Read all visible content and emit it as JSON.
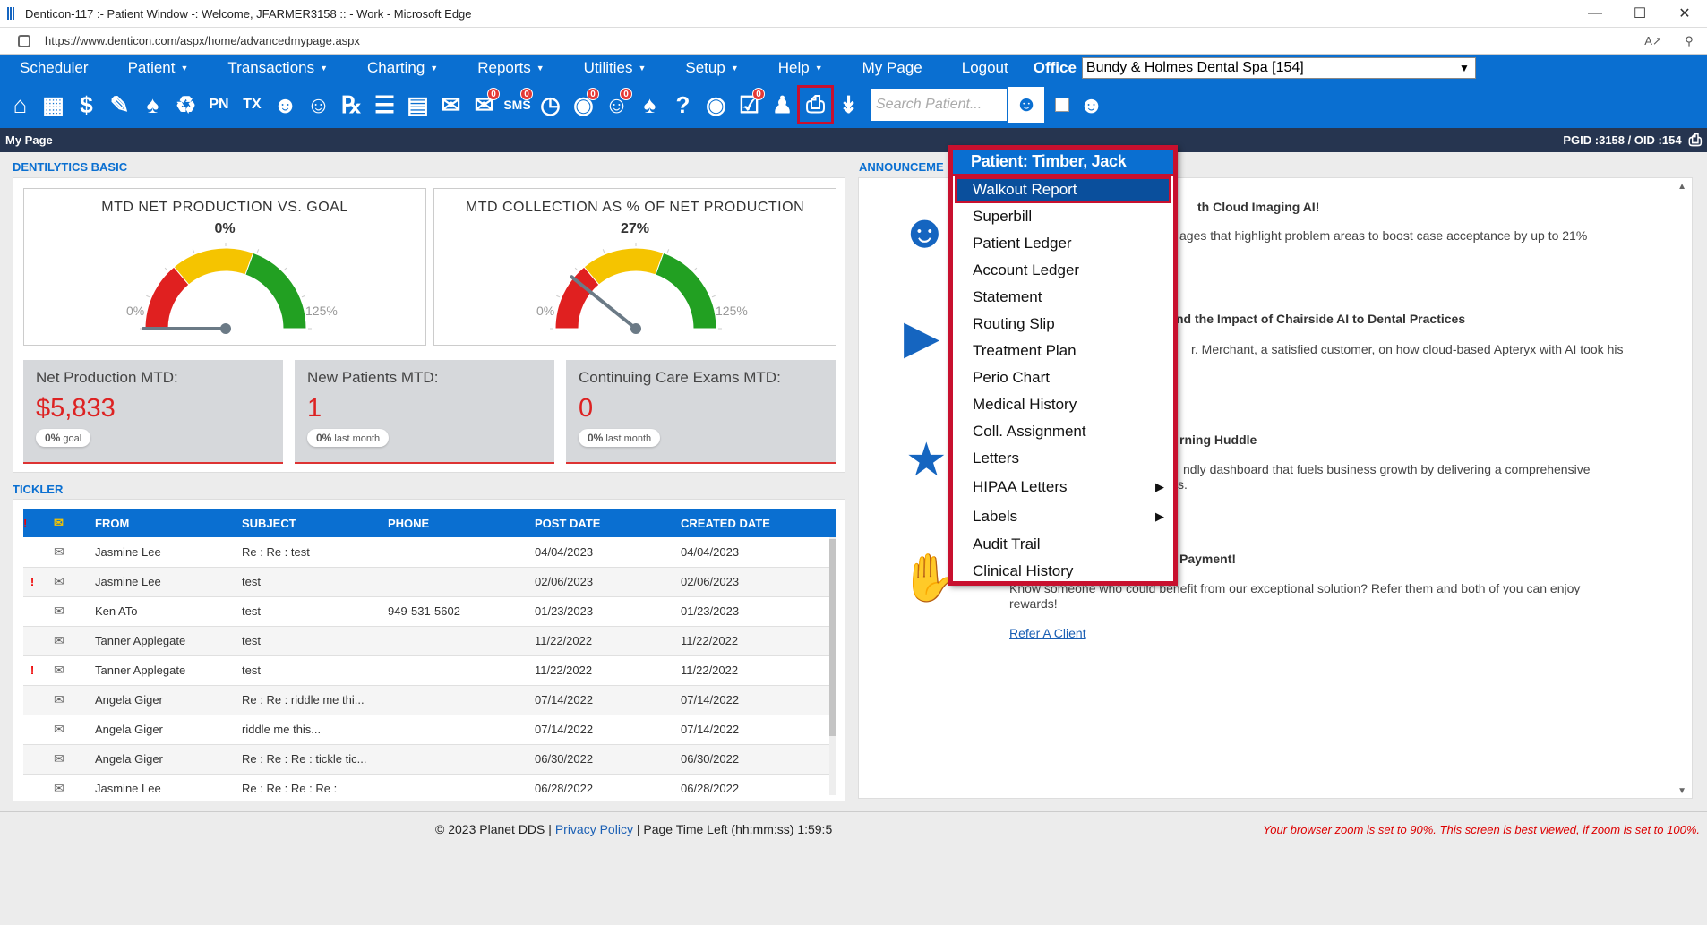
{
  "window": {
    "title": "Denticon-117 :- Patient Window -: Welcome, JFARMER3158 :: - Work - Microsoft Edge",
    "url": "https://www.denticon.com/aspx/home/advancedmypage.aspx"
  },
  "menu": {
    "items": [
      {
        "label": "Scheduler",
        "caret": false
      },
      {
        "label": "Patient",
        "caret": true
      },
      {
        "label": "Transactions",
        "caret": true
      },
      {
        "label": "Charting",
        "caret": true
      },
      {
        "label": "Reports",
        "caret": true
      },
      {
        "label": "Utilities",
        "caret": true
      },
      {
        "label": "Setup",
        "caret": true
      },
      {
        "label": "Help",
        "caret": true
      },
      {
        "label": "My Page",
        "caret": false
      },
      {
        "label": "Logout",
        "caret": false
      }
    ],
    "office_label": "Office",
    "office_value": "Bundy & Holmes Dental Spa [154]"
  },
  "toolbar": {
    "search_placeholder": "Search Patient..."
  },
  "page_header": {
    "title": "My Page",
    "ids": "PGID :3158  /  OID :154"
  },
  "dentilytics": {
    "section_title": "DENTILYTICS BASIC",
    "gauges": [
      {
        "title": "MTD NET PRODUCTION VS. GOAL",
        "value": "0%",
        "min_label": "0%",
        "max_label": "125%",
        "fraction": 0.0
      },
      {
        "title": "MTD COLLECTION AS % OF NET PRODUCTION",
        "value": "27%",
        "min_label": "0%",
        "max_label": "125%",
        "fraction": 0.216
      }
    ],
    "stats": [
      {
        "title": "Net Production MTD:",
        "value": "$5,833",
        "pill_pct": "0%",
        "pill_text": "goal"
      },
      {
        "title": "New Patients MTD:",
        "value": "1",
        "pill_pct": "0%",
        "pill_text": "last month"
      },
      {
        "title": "Continuing Care Exams MTD:",
        "value": "0",
        "pill_pct": "0%",
        "pill_text": "last month"
      }
    ]
  },
  "tickler": {
    "section_title": "TICKLER",
    "columns": [
      "FROM",
      "SUBJECT",
      "PHONE",
      "POST DATE",
      "CREATED DATE"
    ],
    "rows": [
      {
        "flag": "",
        "from": "Jasmine Lee",
        "subject": "Re : Re : test",
        "phone": "",
        "post": "04/04/2023",
        "created": "04/04/2023"
      },
      {
        "flag": "!",
        "from": "Jasmine Lee",
        "subject": "test",
        "phone": "",
        "post": "02/06/2023",
        "created": "02/06/2023"
      },
      {
        "flag": "",
        "from": "Ken ATo",
        "subject": "test",
        "phone": "949-531-5602",
        "post": "01/23/2023",
        "created": "01/23/2023"
      },
      {
        "flag": "",
        "from": "Tanner Applegate",
        "subject": "test",
        "phone": "",
        "post": "11/22/2022",
        "created": "11/22/2022"
      },
      {
        "flag": "!",
        "from": "Tanner Applegate",
        "subject": "test",
        "phone": "",
        "post": "11/22/2022",
        "created": "11/22/2022"
      },
      {
        "flag": "",
        "from": "Angela Giger",
        "subject": "Re : Re : riddle me thi...",
        "phone": "",
        "post": "07/14/2022",
        "created": "07/14/2022"
      },
      {
        "flag": "",
        "from": "Angela Giger",
        "subject": "riddle me this...",
        "phone": "",
        "post": "07/14/2022",
        "created": "07/14/2022"
      },
      {
        "flag": "",
        "from": "Angela Giger",
        "subject": "Re : Re : Re : tickle tic...",
        "phone": "",
        "post": "06/30/2022",
        "created": "06/30/2022"
      },
      {
        "flag": "",
        "from": "Jasmine Lee",
        "subject": "Re : Re : Re : Re :",
        "phone": "",
        "post": "06/28/2022",
        "created": "06/28/2022"
      }
    ]
  },
  "announcements": {
    "section_title": "ANNOUNCEME",
    "items": [
      {
        "head": "th Cloud Imaging AI!",
        "text": "ages that highlight problem areas to boost case acceptance by up to 21%"
      },
      {
        "head": "nd the Impact of Chairside AI to Dental Practices",
        "text": "r. Merchant, a satisfied customer, on how cloud-based Apteryx with AI took his"
      },
      {
        "head": "rning Huddle",
        "text": "ndly dashboard that fuels business growth by delivering a comprehensive",
        "text2": "s."
      },
      {
        "head": "Payment!",
        "text": "Know someone who could benefit from our exceptional solution? Refer them and both of you can enjoy",
        "text2": "rewards!",
        "link": "Refer A Client"
      }
    ]
  },
  "print_menu": {
    "header": "Patient: Timber, Jack",
    "items": [
      {
        "label": "Walkout Report",
        "submenu": false,
        "selected": true
      },
      {
        "label": "Superbill",
        "submenu": false
      },
      {
        "label": "Patient Ledger",
        "submenu": false
      },
      {
        "label": "Account Ledger",
        "submenu": false
      },
      {
        "label": "Statement",
        "submenu": false
      },
      {
        "label": "Routing Slip",
        "submenu": false
      },
      {
        "label": "Treatment Plan",
        "submenu": false
      },
      {
        "label": "Perio Chart",
        "submenu": false
      },
      {
        "label": "Medical History",
        "submenu": false
      },
      {
        "label": "Coll. Assignment",
        "submenu": false
      },
      {
        "label": "Letters",
        "submenu": false
      },
      {
        "label": "HIPAA Letters",
        "submenu": true
      },
      {
        "label": "Labels",
        "submenu": true
      },
      {
        "label": "Audit Trail",
        "submenu": false
      },
      {
        "label": "Clinical History",
        "submenu": false
      }
    ]
  },
  "footer": {
    "copyright": "© 2023 Planet DDS | ",
    "privacy": "Privacy Policy",
    "time_left": " | Page Time Left (hh:mm:ss) 1:59:5",
    "zoom_notice": "Your browser zoom is set to 90%. This screen is best viewed, if zoom is set to 100%."
  },
  "colors": {
    "primary": "#0a6fd1",
    "header_dark": "#263550",
    "highlight": "#c8102e",
    "gauge_red": "#e02020",
    "gauge_yellow": "#f5c400",
    "gauge_green": "#22a022"
  }
}
